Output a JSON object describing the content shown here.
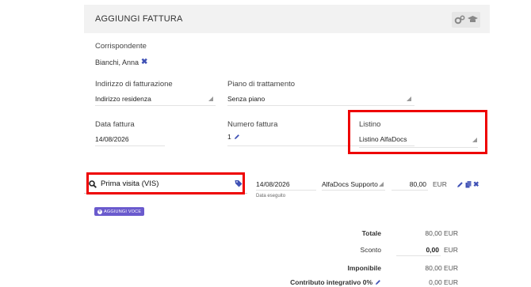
{
  "header": {
    "title": "AGGIUNGI FATTURA",
    "tools_icon": "gears-graduation-cap-icon"
  },
  "corrispondente": {
    "label": "Corrispondente",
    "value": "Bianchi, Anna",
    "remove_icon": "close-icon"
  },
  "indirizzo": {
    "label": "Indirizzo di fatturazione",
    "value": "Indirizzo residenza"
  },
  "piano": {
    "label": "Piano di trattamento",
    "value": "Senza piano"
  },
  "data_fattura": {
    "label": "Data fattura",
    "value": "14/08/2026"
  },
  "numero_fattura": {
    "label": "Numero fattura",
    "value": "1"
  },
  "listino": {
    "label": "Listino",
    "value": "Listino AlfaDocs"
  },
  "item": {
    "description": "Prima visita (VIS)",
    "date": "14/08/2026",
    "date_caption": "Data eseguito",
    "operator": "AlfaDocs Supporto",
    "amount": "80,00",
    "currency": "EUR"
  },
  "add_voice_label": "AGGIUNGI VOCE",
  "totals": {
    "totale_label": "Totale",
    "totale_value": "80,00 EUR",
    "sconto_label": "Sconto",
    "sconto_value": "0,00",
    "sconto_currency": "EUR",
    "imponibile_label": "Imponibile",
    "imponibile_value": "80,00 EUR",
    "contributo_label": "Contributo integrativo 0%",
    "contributo_value": "0,00 EUR"
  },
  "colors": {
    "accent": "#3f51b5",
    "highlight": "#ee0000",
    "button": "#6a5acd"
  }
}
